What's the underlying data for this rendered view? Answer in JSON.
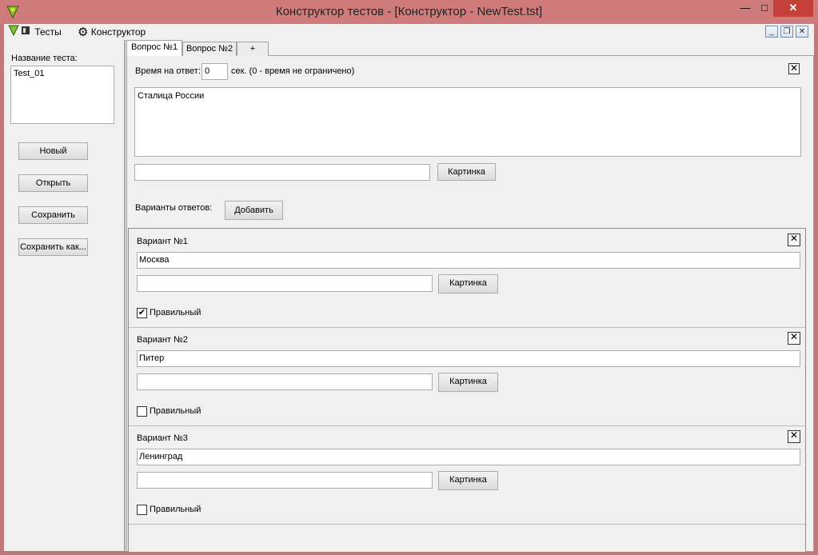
{
  "window": {
    "title": "Конструктор тестов - [Конструктор - NewTest.tst]"
  },
  "menu": {
    "tests": "Тесты",
    "constructor": "Конструктор"
  },
  "sidebar": {
    "test_name_label": "Название теста:",
    "test_name_value": "Test_01",
    "buttons": {
      "new": "Новый",
      "open": "Открыть",
      "save": "Сохранить",
      "save_as": "Сохранить как..."
    }
  },
  "tabs": [
    {
      "label": "Вопрос №1",
      "active": true
    },
    {
      "label": "Вопрос №2",
      "active": false
    },
    {
      "label": "+",
      "active": false
    }
  ],
  "question": {
    "time_label": "Время на ответ:",
    "time_value": "0",
    "time_hint": "сек.  (0 - время не ограничено)",
    "text": "Сталица России",
    "picture_path": "",
    "picture_button": "Картинка",
    "answers_label": "Варианты ответов:",
    "add_button": "Добавить"
  },
  "variants": [
    {
      "title": "Вариант №1",
      "text": "Москва",
      "picture_path": "",
      "picture_button": "Картинка",
      "correct_label": "Правильный",
      "correct": true
    },
    {
      "title": "Вариант №2",
      "text": "Питер",
      "picture_path": "",
      "picture_button": "Картинка",
      "correct_label": "Правильный",
      "correct": false
    },
    {
      "title": "Вариант №3",
      "text": "Ленинград",
      "picture_path": "",
      "picture_button": "Картинка",
      "correct_label": "Правильный",
      "correct": false
    }
  ],
  "colors": {
    "titlebar": "#cf7b7b",
    "close_button": "#c6403a",
    "panel": "#f0f0f0"
  }
}
